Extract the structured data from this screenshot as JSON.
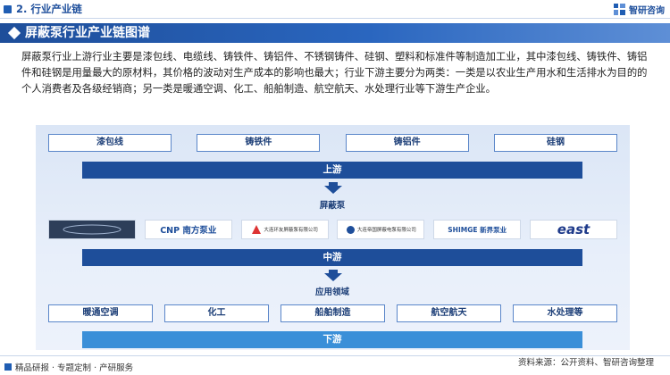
{
  "header": {
    "section_label": "2. 行业产业链",
    "brand_name": "智研咨询"
  },
  "title": "屏蔽泵行业产业链图谱",
  "intro": "屏蔽泵行业上游行业主要是漆包线、电缆线、铸铁件、铸铝件、不锈钢铸件、硅钢、塑料和标准件等制造加工业，其中漆包线、铸铁件、铸铝件和硅钢是用量最大的原材料，其价格的波动对生产成本的影响也最大；行业下游主要分为两类：一类是以农业生产用水和生活排水为目的的个人消费者及各级经销商；另一类是暖通空调、化工、船舶制造、航空航天、水处理行业等下游生产企业。",
  "upstream": {
    "items": [
      "漆包线",
      "铸铁件",
      "铸铝件",
      "硅钢"
    ],
    "band_label": "上游"
  },
  "midstream": {
    "label": "屏蔽泵",
    "logos": [
      {
        "name": "dark-logo",
        "text": ""
      },
      {
        "name": "cnp-logo",
        "text": "CNP 南方泵业"
      },
      {
        "name": "dalian-huanyou-logo",
        "text": "大连环友屏蔽泵有限公司"
      },
      {
        "name": "dalian-diguo-logo",
        "text": "大连帝国屏蔽电泵有限公司"
      },
      {
        "name": "shimge-logo",
        "text": "SHIMGE 新界泵业"
      },
      {
        "name": "east-logo",
        "text": "east"
      }
    ],
    "band_label": "中游"
  },
  "downstream": {
    "label": "应用领域",
    "items": [
      "暖通空调",
      "化工",
      "船舶制造",
      "航空航天",
      "水处理等"
    ],
    "band_label": "下游"
  },
  "footer": {
    "left": "精品研报 · 专题定制 · 产研服务",
    "right": "资料来源：公开资料、智研咨询整理"
  },
  "colors": {
    "primary": "#1e4e9a",
    "accent": "#3a8fd8",
    "panel": "#dbe6f6"
  }
}
